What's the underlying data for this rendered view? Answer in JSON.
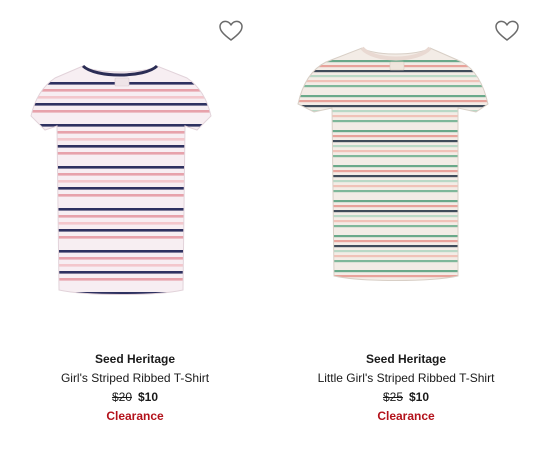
{
  "products": [
    {
      "brand": "Seed Heritage",
      "name": "Girl's Striped Ribbed T-Shirt",
      "compare_price": "$20",
      "price": "$10",
      "tag": "Clearance",
      "wishlist_icon": "heart-outline-icon"
    },
    {
      "brand": "Seed Heritage",
      "name": "Little Girl's Striped Ribbed T-Shirt",
      "compare_price": "$25",
      "price": "$10",
      "tag": "Clearance",
      "wishlist_icon": "heart-outline-icon"
    }
  ],
  "colors": {
    "text": "#1a1a1a",
    "clearance": "#b3121b",
    "icon_stroke": "#6b6b6b"
  }
}
